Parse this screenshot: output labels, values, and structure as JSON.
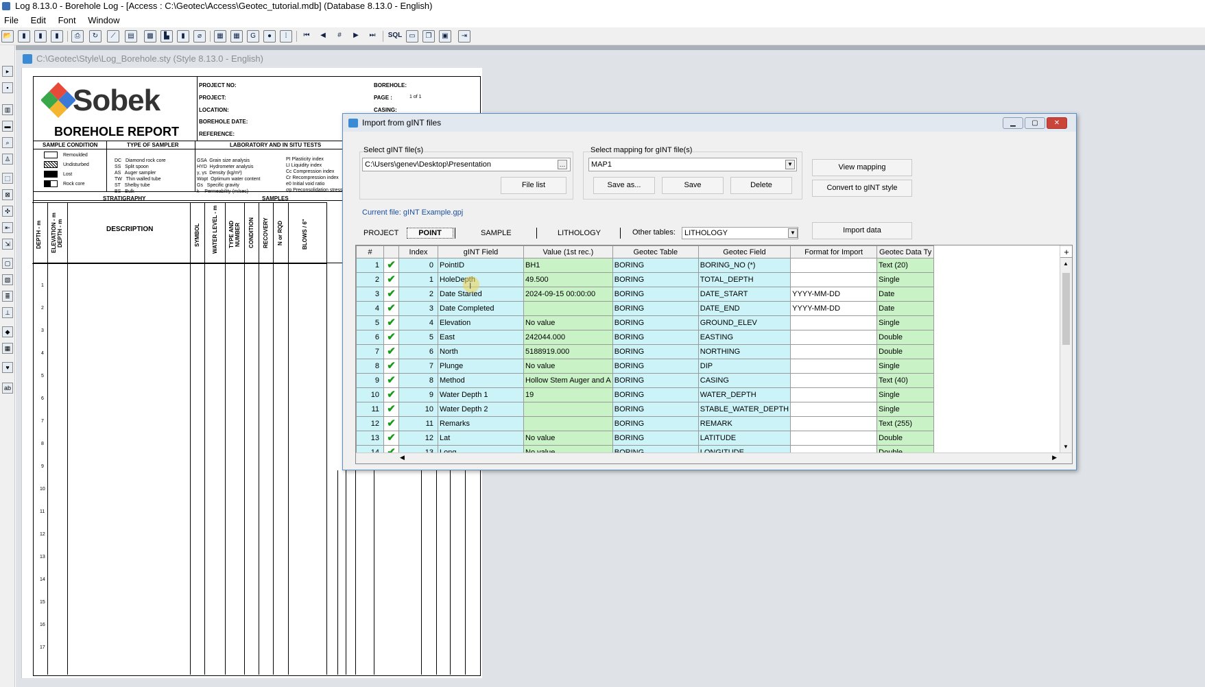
{
  "window": {
    "title": "Log 8.13.0 - Borehole Log - [Access : C:\\Geotec\\Access\\Geotec_tutorial.mdb] (Database 8.13.0 - English)"
  },
  "menu": [
    "File",
    "Edit",
    "Font",
    "Window"
  ],
  "toolbar": {
    "sql_label": "SQL"
  },
  "document": {
    "title": "C:\\Geotec\\Style\\Log_Borehole.sty (Style 8.13.0 - English)"
  },
  "report": {
    "logo": "Sobek",
    "title": "BOREHOLE REPORT",
    "fields": [
      "PROJECT NO:",
      "PROJECT:",
      "LOCATION:",
      "BOREHOLE DATE:",
      "REFERENCE:"
    ],
    "fields_right": [
      "BOREHOLE:",
      "PAGE :",
      "CASING:"
    ],
    "page_value": "1 of 1",
    "legend_headers": [
      "SAMPLE CONDITION",
      "TYPE OF SAMPLER",
      "LABORATORY AND IN SITU TESTS"
    ],
    "conditions": [
      "Remoulded",
      "Undisturbed",
      "Lost",
      "Rock core"
    ],
    "samplers": [
      "DC   Diamond rock core",
      "SS   Split spoon",
      "AS   Auger sampler",
      "TW   Thin walled tube",
      "ST   Shelby tube",
      "BS   Bulk"
    ],
    "tests": [
      "GSA  Grain size analysis",
      "HYD  Hydrometer analysis",
      "γ, γs  Density (kg/m³)",
      "Wopt  Optimum water content",
      "Gs   Specific gravity",
      "k    Permeability (m/sec)"
    ],
    "tests2": [
      "PI Plasticity index",
      "LI Liquidity index",
      "Cc Compression index",
      "Cr Recompression index",
      "e0 Initial void ratio",
      "σp Preconsolidation stress"
    ],
    "section_headers": [
      "STRATIGRAPHY",
      "SAMPLES"
    ],
    "columns": [
      "DEPTH - m",
      "ELEVATION - m DEPTH - m",
      "DESCRIPTION",
      "SYMBOL",
      "WATER LEVEL - m",
      "TYPE AND NUMBER",
      "CONDITION",
      "RECOVERY",
      "N or RQD",
      "BLOWS / 6\""
    ],
    "depth_ticks": [
      "1",
      "2",
      "3",
      "4",
      "5",
      "6",
      "7",
      "8",
      "9",
      "10",
      "11",
      "12",
      "13",
      "14",
      "15",
      "16",
      "17"
    ]
  },
  "dialog": {
    "title": "Import from gINT files",
    "select_files_label": "Select gINT file(s)",
    "file_path": "C:\\Users\\genev\\Desktop\\Presentation",
    "file_list_button": "File list",
    "select_mapping_label": "Select mapping for gINT file(s)",
    "mapping_value": "MAP1",
    "save_as_button": "Save as...",
    "save_button": "Save",
    "delete_button": "Delete",
    "view_mapping_button": "View mapping",
    "convert_button": "Convert to gINT style",
    "current_file": "Current file: gINT Example.gpj",
    "tabs": [
      "PROJECT",
      "POINT",
      "SAMPLE",
      "LITHOLOGY"
    ],
    "other_tables_label": "Other tables:",
    "other_tables_value": "LITHOLOGY",
    "import_button": "Import data",
    "table": {
      "headers": [
        "#",
        "",
        "Index",
        "gINT Field",
        "Value (1st rec.)",
        "Geotec Table",
        "Geotec Field",
        "Format for Import",
        "Geotec Data Ty"
      ],
      "rows": [
        [
          "1",
          "0",
          "PointID",
          "BH1",
          "BORING",
          "BORING_NO (*)",
          "",
          "Text (20)"
        ],
        [
          "2",
          "1",
          "HoleDepth",
          "49.500",
          "BORING",
          "TOTAL_DEPTH",
          "",
          "Single"
        ],
        [
          "3",
          "2",
          "Date Started",
          "2024-09-15 00:00:00",
          "BORING",
          "DATE_START",
          "YYYY-MM-DD",
          "Date"
        ],
        [
          "4",
          "3",
          "Date Completed",
          "",
          "BORING",
          "DATE_END",
          "YYYY-MM-DD",
          "Date"
        ],
        [
          "5",
          "4",
          "Elevation",
          "No value",
          "BORING",
          "GROUND_ELEV",
          "",
          "Single"
        ],
        [
          "6",
          "5",
          "East",
          "242044.000",
          "BORING",
          "EASTING",
          "",
          "Double"
        ],
        [
          "7",
          "6",
          "North",
          "5188919.000",
          "BORING",
          "NORTHING",
          "",
          "Double"
        ],
        [
          "8",
          "7",
          "Plunge",
          "No value",
          "BORING",
          "DIP",
          "",
          "Single"
        ],
        [
          "9",
          "8",
          "Method",
          "Hollow Stem Auger and A",
          "BORING",
          "CASING",
          "",
          "Text (40)"
        ],
        [
          "10",
          "9",
          "Water Depth 1",
          "19",
          "BORING",
          "WATER_DEPTH",
          "",
          "Single"
        ],
        [
          "11",
          "10",
          "Water Depth 2",
          "",
          "BORING",
          "STABLE_WATER_DEPTH",
          "",
          "Single"
        ],
        [
          "12",
          "11",
          "Remarks",
          "",
          "BORING",
          "REMARK",
          "",
          "Text (255)"
        ],
        [
          "13",
          "12",
          "Lat",
          "No value",
          "BORING",
          "LATITUDE",
          "",
          "Double"
        ],
        [
          "14",
          "13",
          "Long",
          "No value",
          "BORING",
          "LONGITUDE",
          "",
          "Double"
        ]
      ]
    }
  },
  "colors": {
    "key_cyan": "#ccf3f7",
    "type_green": "#c9f2c7",
    "check_green": "#1a9a1a",
    "close_red": "#c9453a"
  }
}
